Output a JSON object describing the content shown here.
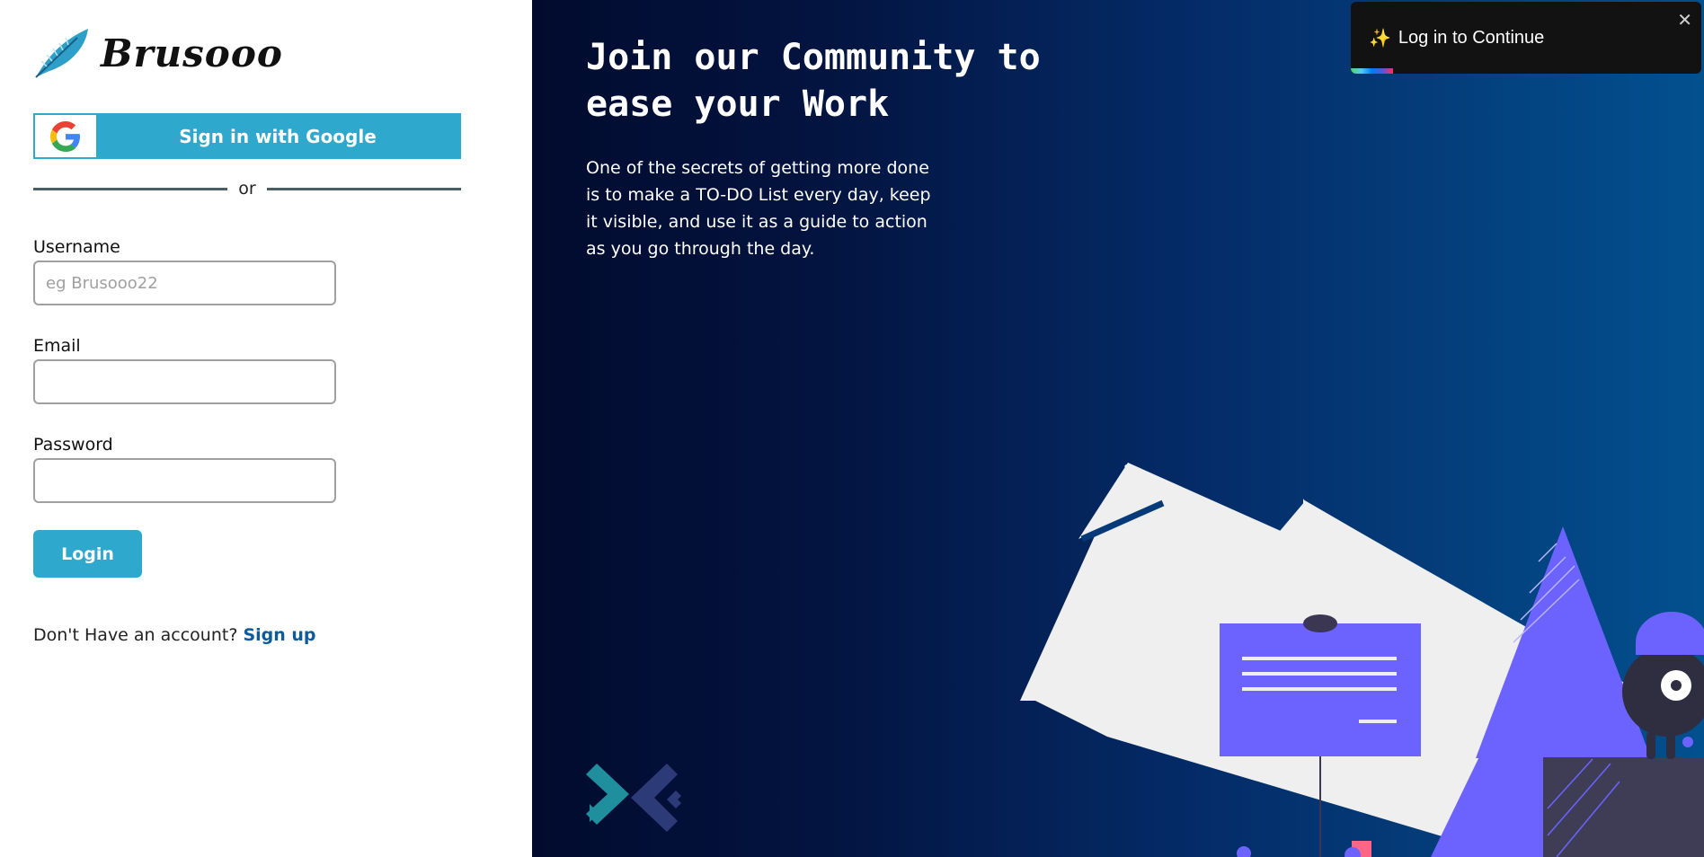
{
  "brand": {
    "name": "Brusooo"
  },
  "google": {
    "label": "Sign in with Google"
  },
  "divider": {
    "text": "or"
  },
  "form": {
    "username_label": "Username",
    "username_placeholder": "eg Brusooo22",
    "username_value": "",
    "email_label": "Email",
    "email_value": "",
    "password_label": "Password",
    "password_value": "",
    "login_label": "Login"
  },
  "signup": {
    "prompt": "Don't Have an account?",
    "link": "Sign up"
  },
  "hero": {
    "title": "Join our Community to ease your Work",
    "text": "One of the secrets of getting more done is to make a TO-DO List every day, keep it visible, and use it as a guide to action as you go through the day."
  },
  "toast": {
    "icon": "sparkles-icon",
    "message": "Log in to Continue",
    "close": "✕",
    "progress": 0.12
  },
  "colors": {
    "accent": "#2ea8cc",
    "link": "#0e5a9c",
    "hero_dark": "#020b2e",
    "hero_light": "#03508f",
    "illustration_purple": "#6c63ff"
  }
}
